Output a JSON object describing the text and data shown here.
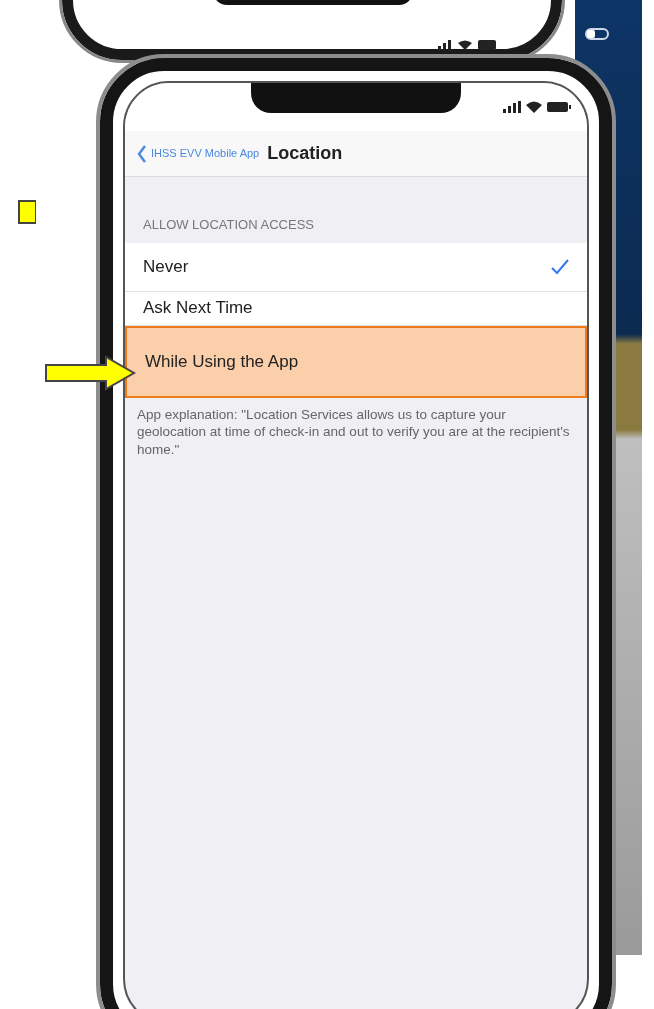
{
  "nav": {
    "back_label": "IHSS EVV Mobile App",
    "title": "Location"
  },
  "section_header": "ALLOW LOCATION ACCESS",
  "options": [
    {
      "label": "Never",
      "selected": true,
      "highlighted": false
    },
    {
      "label": "Ask Next Time",
      "selected": false,
      "highlighted": false
    },
    {
      "label": "While Using the App",
      "selected": false,
      "highlighted": true
    }
  ],
  "footer": "App explanation: \"Location Services allows us to capture your geolocation at time of check-in and out to verify you are at the recipient's home.\""
}
